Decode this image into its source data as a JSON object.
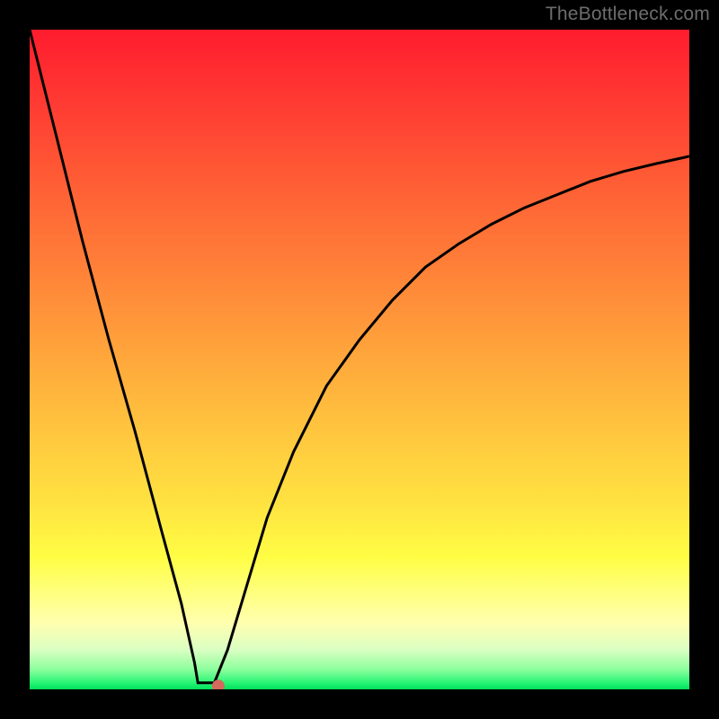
{
  "watermark": "TheBottleneck.com",
  "chart_data": {
    "type": "line",
    "title": "",
    "xlabel": "",
    "ylabel": "",
    "xlim": [
      0,
      100
    ],
    "ylim": [
      0,
      100
    ],
    "grid": false,
    "legend": false,
    "annotations": [],
    "description": "V-shaped bottleneck curve on a rainbow heat gradient (red top to green bottom). Sharp minimum near x≈28 with a small flat floor, steep descent from top-left, and a smoothly decelerating rise toward the right side.",
    "minimum_point": {
      "x": 28,
      "y": 0
    },
    "series": [
      {
        "name": "bottleneck-curve",
        "x": [
          0,
          4,
          8,
          12,
          16,
          20,
          23,
          25,
          25.5,
          28,
          30,
          33,
          36,
          40,
          45,
          50,
          55,
          60,
          65,
          70,
          75,
          80,
          85,
          90,
          95,
          100
        ],
        "y": [
          100,
          84,
          68,
          53,
          39,
          24,
          13,
          4,
          1,
          1,
          6,
          16,
          26,
          36,
          46,
          53,
          59,
          64,
          67.5,
          70.5,
          73,
          75,
          77,
          78.5,
          79.7,
          80.8
        ]
      }
    ],
    "marker": {
      "x": 28.6,
      "y": 0.5,
      "color": "#d36a5d",
      "radius_px": 7
    }
  },
  "colors": {
    "curve": "#000000",
    "marker": "#d36a5d",
    "frame": "#000000"
  }
}
